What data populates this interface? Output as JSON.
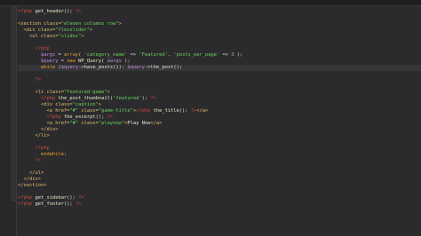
{
  "editor": {
    "lines": [
      {
        "n": 1,
        "tokens": [
          {
            "t": "<?php",
            "c": "php"
          },
          {
            "t": " get_header(); ",
            "c": "fn"
          },
          {
            "t": "?>",
            "c": "php"
          }
        ]
      },
      {
        "n": 2,
        "tokens": []
      },
      {
        "n": 3,
        "tokens": [
          {
            "t": "<section ",
            "c": "tag"
          },
          {
            "t": "class=",
            "c": "attr"
          },
          {
            "t": "\"eleven columns row\"",
            "c": "str"
          },
          {
            "t": ">",
            "c": "tag"
          }
        ]
      },
      {
        "n": 4,
        "tokens": [
          {
            "t": "  <div ",
            "c": "tag"
          },
          {
            "t": "class=",
            "c": "attr"
          },
          {
            "t": "\"flexslider\"",
            "c": "str"
          },
          {
            "t": ">",
            "c": "tag"
          }
        ]
      },
      {
        "n": 5,
        "tokens": [
          {
            "t": "    <ul ",
            "c": "tag"
          },
          {
            "t": "class=",
            "c": "attr"
          },
          {
            "t": "\"slides\"",
            "c": "str"
          },
          {
            "t": ">",
            "c": "tag"
          }
        ]
      },
      {
        "n": 6,
        "tokens": []
      },
      {
        "n": 7,
        "tokens": [
          {
            "t": "      <?php",
            "c": "php"
          }
        ]
      },
      {
        "n": 8,
        "tokens": [
          {
            "t": "        $args",
            "c": "var"
          },
          {
            "t": " = ",
            "c": "punc"
          },
          {
            "t": "array",
            "c": "kw"
          },
          {
            "t": "( ",
            "c": "punc"
          },
          {
            "t": "'category_name'",
            "c": "str"
          },
          {
            "t": " => ",
            "c": "punc"
          },
          {
            "t": "'Featured'",
            "c": "str"
          },
          {
            "t": ", ",
            "c": "punc"
          },
          {
            "t": "'posts_per_page'",
            "c": "str"
          },
          {
            "t": " => ",
            "c": "punc"
          },
          {
            "t": "3",
            "c": "num"
          },
          {
            "t": " );",
            "c": "punc"
          }
        ]
      },
      {
        "n": 9,
        "tokens": [
          {
            "t": "        $query",
            "c": "var"
          },
          {
            "t": " = ",
            "c": "punc"
          },
          {
            "t": "new",
            "c": "kw"
          },
          {
            "t": " WP_Query( ",
            "c": "fn"
          },
          {
            "t": "$args",
            "c": "var"
          },
          {
            "t": " );",
            "c": "punc"
          }
        ]
      },
      {
        "n": 10,
        "tokens": [
          {
            "t": "        while",
            "c": "kw"
          },
          {
            "t": " (",
            "c": "punc"
          },
          {
            "t": "$query",
            "c": "var"
          },
          {
            "t": "->have_posts()",
            "c": "fn"
          },
          {
            "t": "): ",
            "c": "punc"
          },
          {
            "t": "$query",
            "c": "var"
          },
          {
            "t": "->the_post();",
            "c": "fn"
          }
        ],
        "highlight": true
      },
      {
        "n": 11,
        "tokens": []
      },
      {
        "n": 12,
        "tokens": [
          {
            "t": "      ?>",
            "c": "php"
          }
        ]
      },
      {
        "n": 13,
        "tokens": []
      },
      {
        "n": 14,
        "tokens": [
          {
            "t": "      <li ",
            "c": "tag"
          },
          {
            "t": "class=",
            "c": "attr"
          },
          {
            "t": "\"featured-game\"",
            "c": "str"
          },
          {
            "t": ">",
            "c": "tag"
          }
        ]
      },
      {
        "n": 15,
        "tokens": [
          {
            "t": "        <?php",
            "c": "php"
          },
          {
            "t": " the_post_thumbnail(",
            "c": "fn"
          },
          {
            "t": "'featured'",
            "c": "str"
          },
          {
            "t": "); ",
            "c": "punc"
          },
          {
            "t": "?>",
            "c": "php"
          }
        ]
      },
      {
        "n": 16,
        "tokens": [
          {
            "t": "        <div ",
            "c": "tag"
          },
          {
            "t": "class=",
            "c": "attr"
          },
          {
            "t": "\"caption\"",
            "c": "str"
          },
          {
            "t": ">",
            "c": "tag"
          }
        ]
      },
      {
        "n": 17,
        "tokens": [
          {
            "t": "          <a ",
            "c": "tag"
          },
          {
            "t": "href=",
            "c": "attr"
          },
          {
            "t": "\"#\"",
            "c": "str"
          },
          {
            "t": " class=",
            "c": "attr"
          },
          {
            "t": "\"game-title\"",
            "c": "str"
          },
          {
            "t": ">",
            "c": "tag"
          },
          {
            "t": "<?php",
            "c": "php"
          },
          {
            "t": " the_title(); ",
            "c": "fn"
          },
          {
            "t": "?>",
            "c": "php"
          },
          {
            "t": "</a>",
            "c": "tag"
          }
        ]
      },
      {
        "n": 18,
        "tokens": [
          {
            "t": "          <?php",
            "c": "php"
          },
          {
            "t": " the_excerpt(); ",
            "c": "fn"
          },
          {
            "t": "?>",
            "c": "php"
          }
        ]
      },
      {
        "n": 19,
        "tokens": [
          {
            "t": "          <a ",
            "c": "tag"
          },
          {
            "t": "href=",
            "c": "attr"
          },
          {
            "t": "\"#\"",
            "c": "str"
          },
          {
            "t": " class=",
            "c": "attr"
          },
          {
            "t": "\"playnow\"",
            "c": "str"
          },
          {
            "t": ">",
            "c": "tag"
          },
          {
            "t": "Play Now",
            "c": "text"
          },
          {
            "t": "</a>",
            "c": "tag"
          }
        ]
      },
      {
        "n": 20,
        "tokens": [
          {
            "t": "        </div>",
            "c": "tag"
          }
        ]
      },
      {
        "n": 21,
        "tokens": [
          {
            "t": "      </li>",
            "c": "tag"
          }
        ]
      },
      {
        "n": 22,
        "tokens": []
      },
      {
        "n": 23,
        "tokens": [
          {
            "t": "      <?php",
            "c": "php"
          }
        ]
      },
      {
        "n": 24,
        "tokens": [
          {
            "t": "        endwhile;",
            "c": "kw"
          }
        ]
      },
      {
        "n": 25,
        "tokens": [
          {
            "t": "      ?>",
            "c": "php"
          }
        ]
      },
      {
        "n": 26,
        "tokens": []
      },
      {
        "n": 27,
        "tokens": [
          {
            "t": "    </ul>",
            "c": "tag"
          }
        ]
      },
      {
        "n": 28,
        "tokens": [
          {
            "t": "  </div>",
            "c": "tag"
          }
        ]
      },
      {
        "n": 29,
        "tokens": [
          {
            "t": "</section>",
            "c": "tag"
          }
        ]
      },
      {
        "n": 30,
        "tokens": []
      },
      {
        "n": 31,
        "tokens": [
          {
            "t": "<?php",
            "c": "php"
          },
          {
            "t": " get_sidebar(); ",
            "c": "fn"
          },
          {
            "t": "?>",
            "c": "php"
          }
        ]
      },
      {
        "n": 32,
        "tokens": [
          {
            "t": "<?php",
            "c": "php"
          },
          {
            "t": " get_footer(); ",
            "c": "fn"
          },
          {
            "t": "?>",
            "c": "php"
          }
        ]
      }
    ]
  }
}
